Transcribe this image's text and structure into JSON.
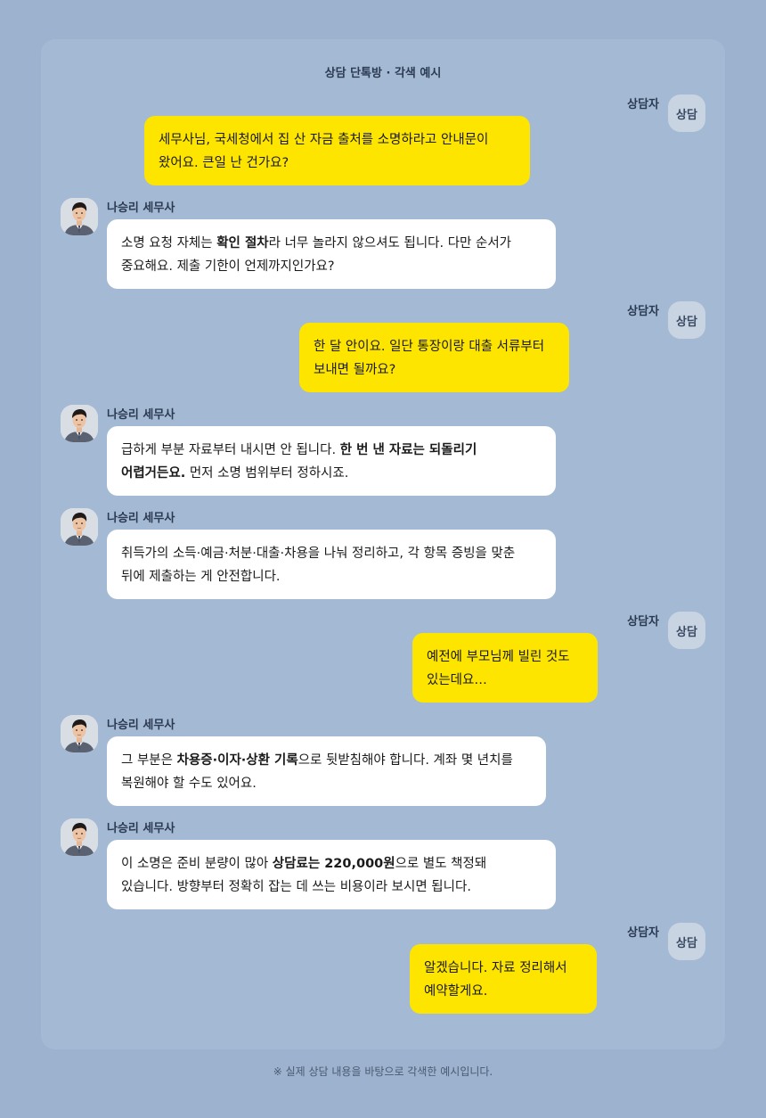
{
  "title": "상담 단톡방 · 각색 예시",
  "user_name": "상담자",
  "user_avatar_label": "상담",
  "advisor_name": "나승리 세무사",
  "messages": [
    {
      "role": "user",
      "parts": [
        {
          "t": "세무사님, 국세청에서 집 산 자금 출처를 소명하라고 안내문이 왔어요. 큰일 난 건가요?"
        }
      ]
    },
    {
      "role": "advisor",
      "parts": [
        {
          "t": "소명 요청 자체는 "
        },
        {
          "t": "확인 절차",
          "b": true
        },
        {
          "t": "라 너무 놀라지 않으셔도 됩니다. 다만 순서가 중요해요. 제출 기한이 언제까지인가요?"
        }
      ]
    },
    {
      "role": "user",
      "parts": [
        {
          "t": "한 달 안이요. 일단 통장이랑 대출 서류부터 보내면 될까요?"
        }
      ]
    },
    {
      "role": "advisor",
      "parts": [
        {
          "t": "급하게 부분 자료부터 내시면 안 됩니다. "
        },
        {
          "t": "한 번 낸 자료는 되돌리기 어렵거든요.",
          "b": true
        },
        {
          "t": " 먼저 소명 범위부터 정하시죠."
        }
      ]
    },
    {
      "role": "advisor",
      "parts": [
        {
          "t": "취득가의 소득·예금·처분·대출·차용을 나눠 정리하고, 각 항목 증빙을 맞춘 뒤에 제출하는 게 안전합니다."
        }
      ]
    },
    {
      "role": "user",
      "parts": [
        {
          "t": "예전에 부모님께 빌린 것도 있는데요…"
        }
      ]
    },
    {
      "role": "advisor",
      "parts": [
        {
          "t": "그 부분은 "
        },
        {
          "t": "차용증·이자·상환 기록",
          "b": true
        },
        {
          "t": "으로 뒷받침해야 합니다. 계좌 몇 년치를 복원해야 할 수도 있어요."
        }
      ]
    },
    {
      "role": "advisor",
      "parts": [
        {
          "t": "이 소명은 준비 분량이 많아 "
        },
        {
          "t": "상담료는 220,000원",
          "b": true
        },
        {
          "t": "으로 별도 책정돼 있습니다. 방향부터 정확히 잡는 데 쓰는 비용이라 보시면 됩니다."
        }
      ]
    },
    {
      "role": "user",
      "parts": [
        {
          "t": "알겠습니다. 자료 정리해서 예약할게요."
        }
      ]
    }
  ],
  "footer": "※ 실제 상담 내용을 바탕으로 각색한 예시입니다.",
  "colors": {
    "background": "#9cb2cf",
    "panel": "#a4bad4",
    "user_bubble": "#fee500",
    "advisor_bubble": "#ffffff"
  }
}
